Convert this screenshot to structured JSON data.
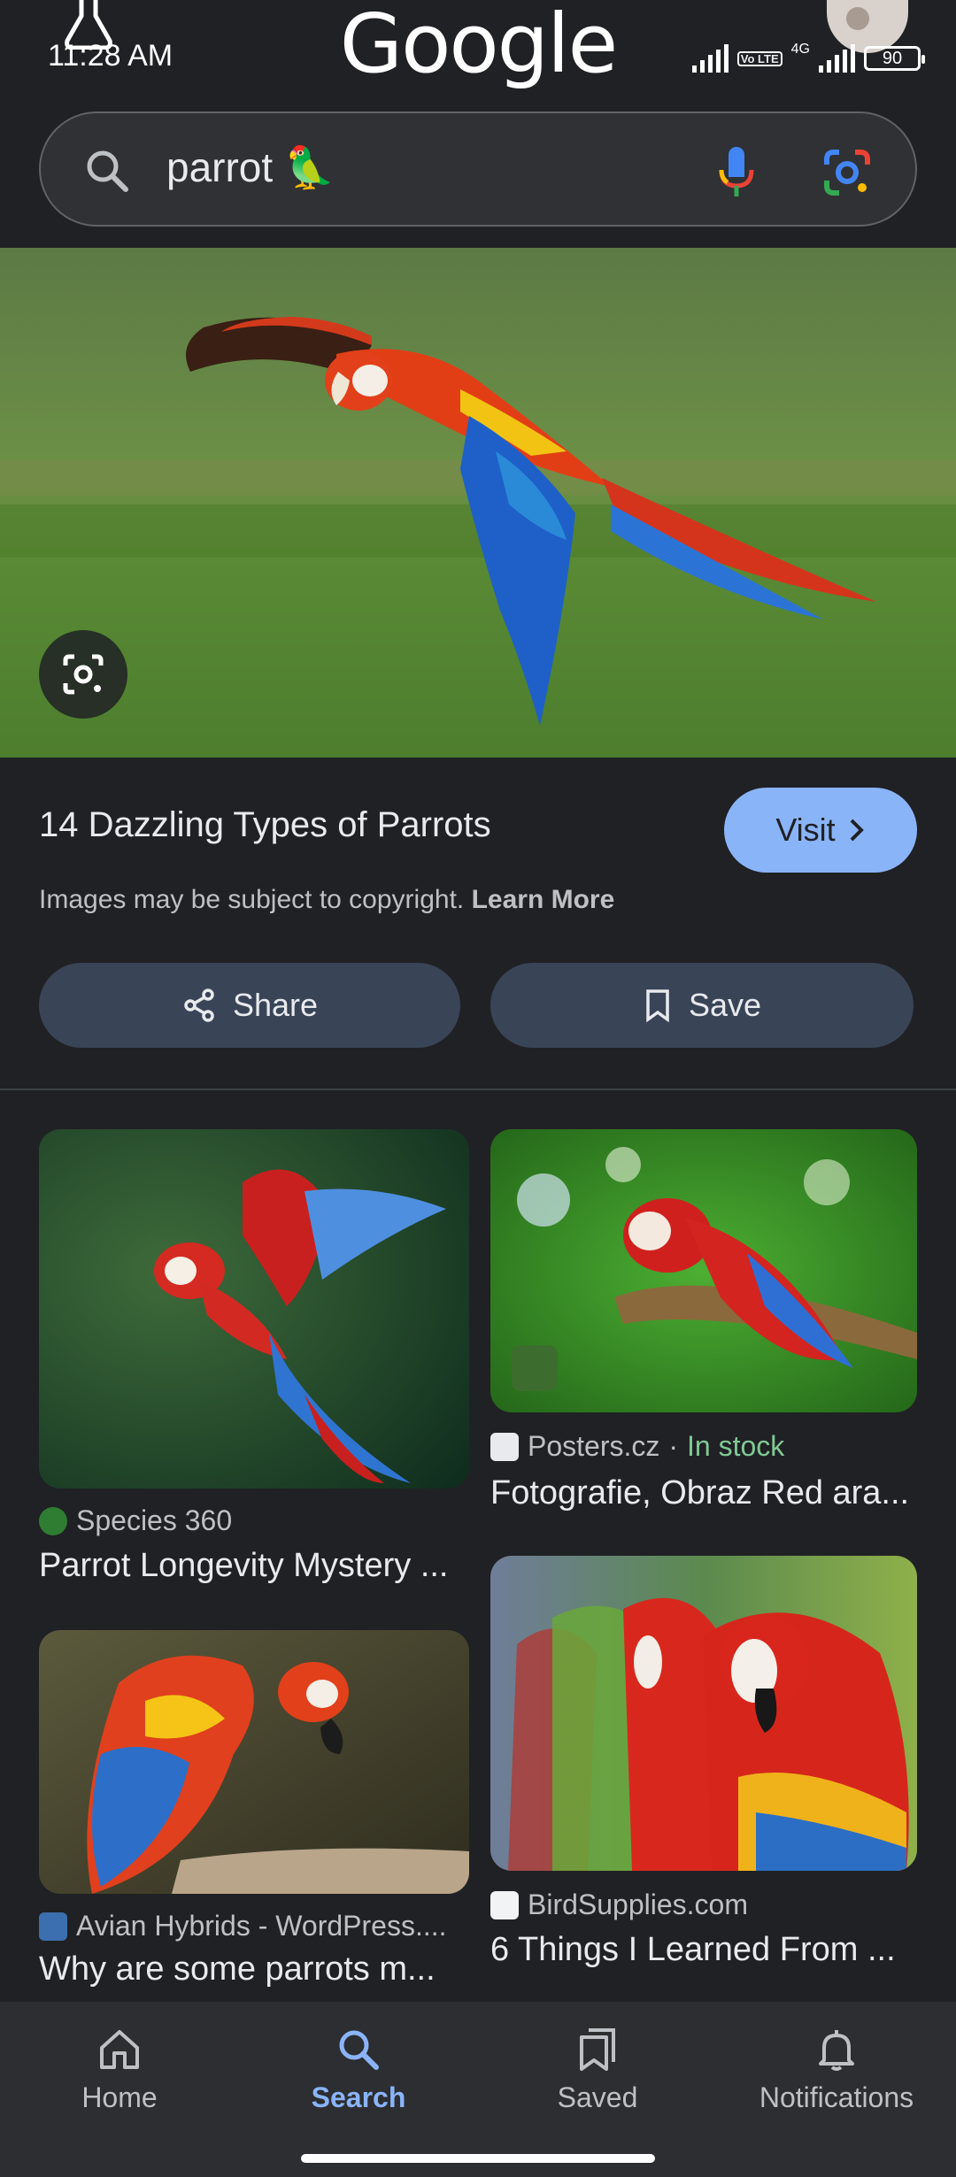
{
  "status_bar": {
    "time": "11:28 AM",
    "network": "4G",
    "volte": "Vo LTE",
    "battery": "90"
  },
  "header": {
    "logo": "Google"
  },
  "search": {
    "query": "parrot 🦜"
  },
  "result": {
    "title": "14 Dazzling Types of Parrots",
    "visit_label": "Visit",
    "copyright_text": "Images may be subject to copyright.",
    "learn_more": "Learn More",
    "share_label": "Share",
    "save_label": "Save"
  },
  "related": [
    {
      "source": "Species 360",
      "stock": "",
      "caption": "Parrot Longevity Mystery ..."
    },
    {
      "source": "Posters.cz",
      "stock": "In stock",
      "caption": "Fotografie, Obraz Red ara..."
    },
    {
      "source": "Avian Hybrids - WordPress....",
      "stock": "",
      "caption": "Why are some parrots m..."
    },
    {
      "source": "BirdSupplies.com",
      "stock": "",
      "caption": "6 Things I Learned From ..."
    }
  ],
  "nav": {
    "home": "Home",
    "search": "Search",
    "saved": "Saved",
    "notifications": "Notifications"
  },
  "colors": {
    "background": "#202124",
    "accent": "#8ab4f8",
    "in_stock": "#81c995"
  }
}
